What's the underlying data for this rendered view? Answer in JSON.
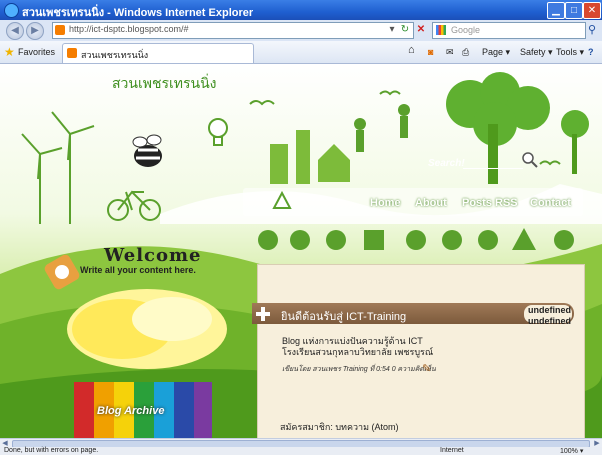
{
  "window": {
    "title": "สวนเพชรเทรนนิ่ง - Windows Internet Explorer"
  },
  "address_bar": {
    "url": "http://ict-dsptc.blogspot.com/#",
    "search_placeholder": "Google"
  },
  "favorites_bar": {
    "favorites_label": "Favorites",
    "tab_title": "สวนเพชรเทรนนิ่ง",
    "commands": [
      "Page ▾",
      "Safety ▾",
      "Tools ▾"
    ]
  },
  "blog": {
    "title": "สวนเพชรเทรนนิ่ง",
    "search_label": "Search!",
    "nav": [
      "Home",
      "About",
      "Posts RSS",
      "Contact"
    ],
    "welcome_title": "Welcome",
    "welcome_subtitle": "Write all your content here.",
    "archive_label": "Blog Archive"
  },
  "post": {
    "heading": "ยินดีต้อนรับสู่ ICT-Training",
    "sidebar_text": "undefined undefined",
    "body_line1": "Blog แห่งการแบ่งปันความรู้ด้าน ICT",
    "body_line2": "โรงเรียนสวนกุหลาบวิทยาลัย เพชรบูรณ์",
    "meta": "เขียนโดย สวนเพชร Training ที่ 0:54   0 ความคิดเห็น",
    "feed_link": "สมัครสมาชิก: บทความ (Atom)"
  },
  "status_bar": {
    "left": "Done, but with errors on page.",
    "zone": "Internet",
    "zoom": "100% ▾"
  },
  "colors": {
    "title_bar": "#1f5fd0",
    "page_green": "#86c13a",
    "post_bar": "#7c5a3c"
  }
}
